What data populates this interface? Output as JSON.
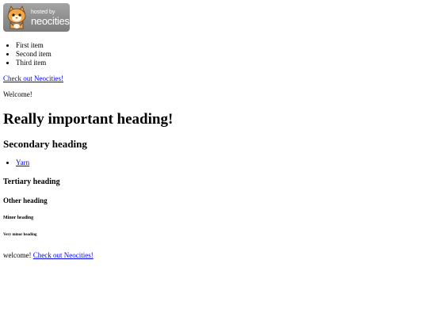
{
  "badge": {
    "hosted_text": "hosted by",
    "site_name": "neocities",
    "colors": {
      "background": "#8e8e8e",
      "cat_orange": "#f0a64a"
    }
  },
  "list_items": [
    "First item",
    "Second item",
    "Third item"
  ],
  "link_text": "Check out Neocities!",
  "welcome_text": "Welcome!",
  "h1": "Really important heading!",
  "h2": "Secondary heading",
  "yarn_link": "Yarn",
  "h3": "Tertiary heading",
  "h4": "Other heading",
  "h5": "Minor heading",
  "h6": "Very minor heading",
  "final": {
    "prefix": "welcome! ",
    "link_text": "Check out Neocities!"
  },
  "colors": {
    "link": "#0000ee",
    "text": "#000000",
    "background": "#ffffff"
  }
}
